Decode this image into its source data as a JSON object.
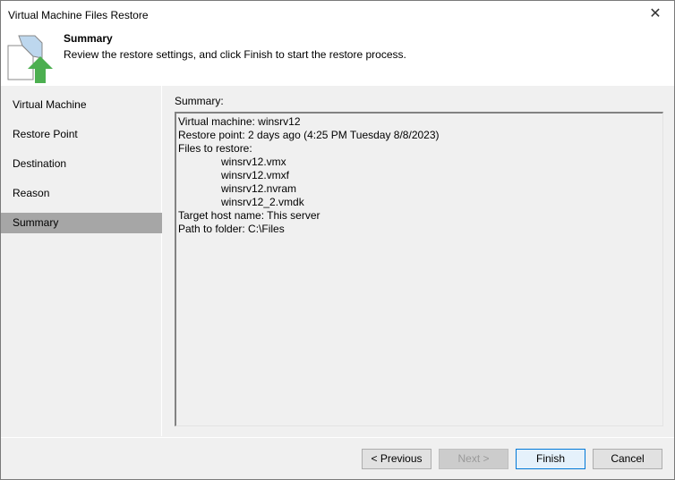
{
  "window": {
    "title": "Virtual Machine Files Restore"
  },
  "header": {
    "title": "Summary",
    "subtitle": "Review the restore settings, and click Finish to start the restore process."
  },
  "sidebar": {
    "items": [
      {
        "label": "Virtual Machine"
      },
      {
        "label": "Restore Point"
      },
      {
        "label": "Destination"
      },
      {
        "label": "Reason"
      },
      {
        "label": "Summary",
        "selected": true
      }
    ]
  },
  "summary": {
    "label": "Summary:",
    "lines": [
      "Virtual machine: winsrv12",
      "Restore point: 2 days ago (4:25 PM Tuesday 8/8/2023)",
      "Files to restore:",
      "winsrv12.vmx",
      "winsrv12.vmxf",
      "winsrv12.nvram",
      "winsrv12_2.vmdk",
      "Target host name: This server",
      "Path to folder: C:\\Files"
    ]
  },
  "buttons": {
    "previous": "< Previous",
    "next": "Next >",
    "finish": "Finish",
    "cancel": "Cancel"
  }
}
